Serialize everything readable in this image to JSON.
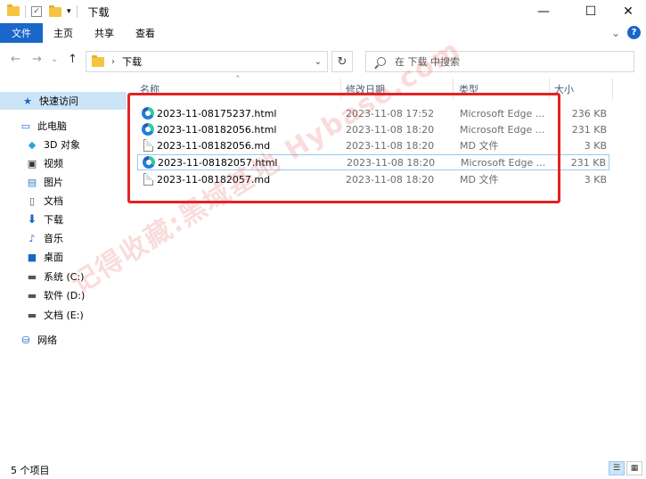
{
  "window": {
    "title": "下载",
    "minimize": "—",
    "maximize": "☐",
    "close": "✕"
  },
  "ribbon": {
    "tabs": [
      "文件",
      "主页",
      "共享",
      "查看"
    ],
    "expand": "⌄",
    "help": "?"
  },
  "address": {
    "back": "←",
    "forward": "→",
    "recent": "⌄",
    "up": "↑",
    "separator": "›",
    "path": "下载",
    "dropdown": "⌄",
    "refresh": "↻"
  },
  "search": {
    "placeholder": "在 下载 中搜索"
  },
  "sidebar": {
    "items": [
      {
        "label": "快速访问",
        "icon": "star-icon"
      },
      {
        "label": "此电脑",
        "icon": "computer-icon"
      },
      {
        "label": "3D 对象",
        "icon": "cube-icon"
      },
      {
        "label": "视频",
        "icon": "video-icon"
      },
      {
        "label": "图片",
        "icon": "picture-icon"
      },
      {
        "label": "文档",
        "icon": "document-icon"
      },
      {
        "label": "下载",
        "icon": "download-icon"
      },
      {
        "label": "音乐",
        "icon": "music-icon"
      },
      {
        "label": "桌面",
        "icon": "desktop-icon"
      },
      {
        "label": "系统 (C:)",
        "icon": "drive-icon"
      },
      {
        "label": "软件 (D:)",
        "icon": "drive-icon"
      },
      {
        "label": "文档 (E:)",
        "icon": "drive-icon"
      },
      {
        "label": "网络",
        "icon": "network-icon"
      }
    ]
  },
  "columns": {
    "name": "名称",
    "date": "修改日期",
    "type": "类型",
    "size": "大小"
  },
  "files": [
    {
      "name": "2023-11-08175237.html",
      "date": "2023-11-08 17:52",
      "type": "Microsoft Edge ...",
      "size": "236 KB",
      "icon": "edge-icon"
    },
    {
      "name": "2023-11-08182056.html",
      "date": "2023-11-08 18:20",
      "type": "Microsoft Edge ...",
      "size": "231 KB",
      "icon": "edge-icon"
    },
    {
      "name": "2023-11-08182056.md",
      "date": "2023-11-08 18:20",
      "type": "MD 文件",
      "size": "3 KB",
      "icon": "md-file-icon"
    },
    {
      "name": "2023-11-08182057.html",
      "date": "2023-11-08 18:20",
      "type": "Microsoft Edge ...",
      "size": "231 KB",
      "icon": "edge-icon"
    },
    {
      "name": "2023-11-08182057.md",
      "date": "2023-11-08 18:20",
      "type": "MD 文件",
      "size": "3 KB",
      "icon": "md-file-icon"
    }
  ],
  "watermark": "记得收藏:黑域基地 Hybase.com",
  "status": {
    "count": "5 个项目"
  },
  "colors": {
    "accent": "#1a66c9",
    "selection": "#cce4f7",
    "annotation_box": "#e52222"
  }
}
